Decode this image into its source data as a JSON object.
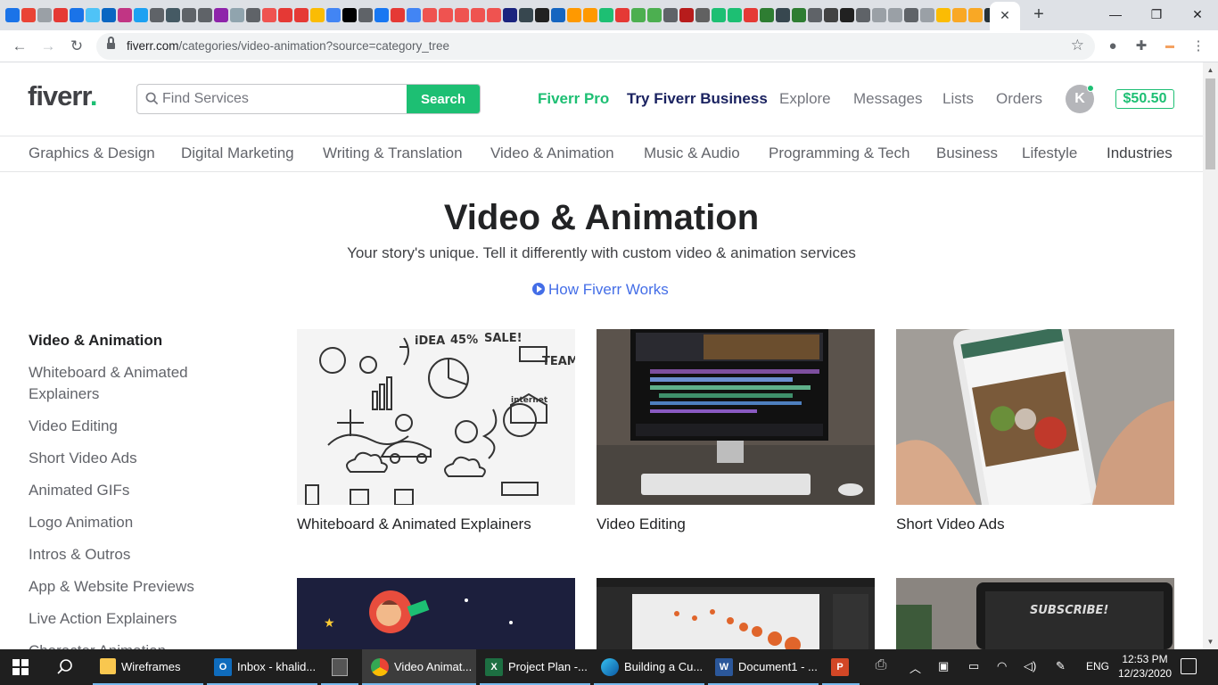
{
  "browser": {
    "url_host": "fiverr.com",
    "url_path": "/categories/video-animation?source=category_tree",
    "tab_close_icon": "close-icon",
    "colors": {
      "tabstrip": "#dee1e6"
    }
  },
  "header": {
    "logo": "fiverr",
    "logo_dot": ".",
    "search_placeholder": "Find Services",
    "search_button": "Search",
    "nav": {
      "pro": "Fiverr Pro",
      "business": "Try Fiverr Business",
      "explore": "Explore",
      "messages": "Messages",
      "lists": "Lists",
      "orders": "Orders"
    },
    "avatar_initial": "K",
    "balance": "$50.50"
  },
  "categories": [
    "Graphics & Design",
    "Digital Marketing",
    "Writing & Translation",
    "Video & Animation",
    "Music & Audio",
    "Programming & Tech",
    "Business",
    "Lifestyle",
    "Industries"
  ],
  "hero": {
    "title": "Video & Animation",
    "subtitle": "Your story's unique. Tell it differently with custom video & animation services",
    "how_link": "How Fiverr Works"
  },
  "sidebar": {
    "heading": "Video & Animation",
    "items": [
      "Whiteboard & Animated Explainers",
      "Video Editing",
      "Short Video Ads",
      "Animated GIFs",
      "Logo Animation",
      "Intros & Outros",
      "App & Website Previews",
      "Live Action Explainers",
      "Character Animation"
    ]
  },
  "cards": [
    {
      "label": "Whiteboard & Animated Explainers"
    },
    {
      "label": "Video Editing"
    },
    {
      "label": "Short Video Ads"
    },
    {
      "label": ""
    },
    {
      "label": ""
    },
    {
      "label": ""
    }
  ],
  "taskbar": {
    "apps": [
      {
        "label": "Wireframes"
      },
      {
        "label": "Inbox - khalid..."
      },
      {
        "label": ""
      },
      {
        "label": "Video Animat..."
      },
      {
        "label": "Project Plan -..."
      },
      {
        "label": "Building a Cu..."
      },
      {
        "label": "Document1 - ..."
      },
      {
        "label": ""
      }
    ],
    "lang": "ENG",
    "time": "12:53 PM",
    "date": "12/23/2020"
  },
  "accent": "#1dbf73"
}
